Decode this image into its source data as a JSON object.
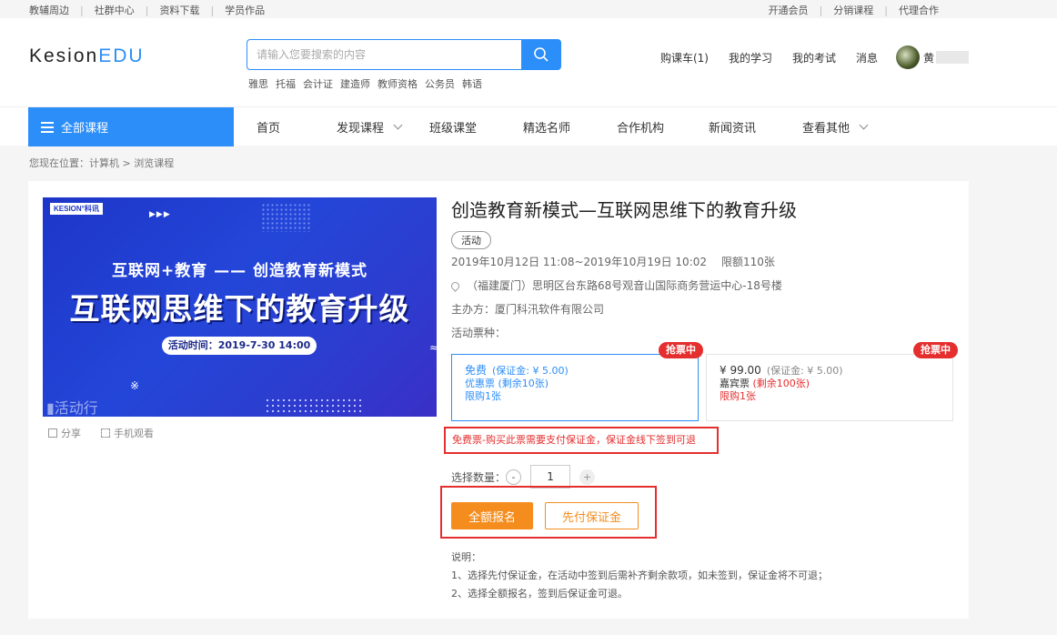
{
  "topbar": {
    "left": [
      "教辅周边",
      "社群中心",
      "资料下载",
      "学员作品"
    ],
    "right": [
      "开通会员",
      "分销课程",
      "代理合作"
    ]
  },
  "header": {
    "logo_a": "Kesion",
    "logo_b": "EDU",
    "search_placeholder": "请输入您要搜索的内容",
    "hotwords": [
      "雅思",
      "托福",
      "会计证",
      "建造师",
      "教师资格",
      "公务员",
      "韩语"
    ],
    "nav": [
      "购课车(1)",
      "我的学习",
      "我的考试",
      "消息"
    ],
    "username": "黄"
  },
  "navbar": {
    "all_courses": "全部课程",
    "links": [
      "首页",
      "发现课程",
      "班级课堂",
      "精选名师",
      "合作机构",
      "新闻资讯",
      "查看其他"
    ]
  },
  "breadcrumb": "您现在位置：计算机 > 浏览课程",
  "banner": {
    "brand": "KESION°科讯",
    "arrows": "▶▶▶",
    "subtitle": "互联网+教育 —— 创造教育新模式",
    "headline": "互联网思维下的教育升级",
    "time": "活动时间：2019-7-30 14:00",
    "watermark": "▮活动行"
  },
  "share": {
    "share_label": "分享",
    "mobile_label": "手机观看"
  },
  "event": {
    "title": "创造教育新模式—互联网思维下的教育升级",
    "tag": "活动",
    "date_range": "2019年10月12日 11:08~2019年10月19日 10:02",
    "limit": "限额110张",
    "location": "（福建厦门）思明区台东路68号观音山国际商务营运中心-18号楼",
    "organizer": "主办方：厦门科汛软件有限公司",
    "ticket_type_label": "活动票种："
  },
  "tickets": [
    {
      "badge": "抢票中",
      "price": "免费",
      "deposit": "(保证金: ¥ 5.00)",
      "kind": "优惠票",
      "remaining": "(剩余10张)",
      "limit": "限购1张"
    },
    {
      "badge": "抢票中",
      "price": "¥ 99.00",
      "deposit": "(保证金: ¥ 5.00)",
      "kind": "嘉宾票",
      "remaining": "(剩余100张)",
      "limit": "限购1张"
    }
  ],
  "notice": "免费票-购买此票需要支付保证金，保证金线下签到可退",
  "quantity": {
    "label": "选择数量：",
    "minus": "-",
    "value": "1",
    "plus": "+"
  },
  "buttons": {
    "full": "全额报名",
    "deposit": "先付保证金"
  },
  "description": {
    "heading": "说明：",
    "line1": "1、选择先付保证金，在活动中签到后需补齐剩余款项，如未签到，保证金将不可退；",
    "line2": "2、选择全额报名，签到后保证金可退。"
  },
  "colors": {
    "accent": "#2c8ef8",
    "orange": "#f58d1e",
    "red": "#e52e2e"
  }
}
